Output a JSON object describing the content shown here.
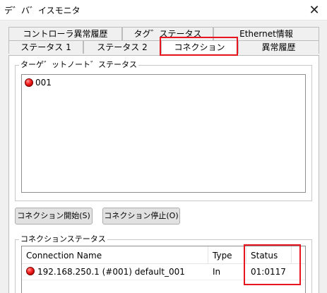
{
  "window": {
    "title": "デ゛バ゛イスモニタ",
    "close_glyph": "✕"
  },
  "tabs": {
    "row1": [
      "コントローラ異常履歴",
      "タグ゛ステータス",
      "Ethernet情報"
    ],
    "row2": [
      "ステータス 1",
      "ステータス 2",
      "コネクション",
      "異常履歴"
    ],
    "active": "コネクション"
  },
  "target_node": {
    "label": "ターゲ゛ットノート゛ステータス",
    "items": [
      {
        "status_color": "red",
        "name": "001"
      }
    ]
  },
  "buttons": {
    "start_connection": "コネクション開始(S)",
    "stop_connection": "コネクション停止(O)"
  },
  "connection_status": {
    "label": "コネクションステータス",
    "columns": [
      "Connection Name",
      "Type",
      "Status"
    ],
    "rows": [
      {
        "status_color": "red",
        "name": "192.168.250.1 (#001) default_001",
        "type": "In",
        "status": "01:0117"
      }
    ]
  },
  "colors": {
    "highlight": "#e8141e",
    "indicator": "#ff3030"
  }
}
